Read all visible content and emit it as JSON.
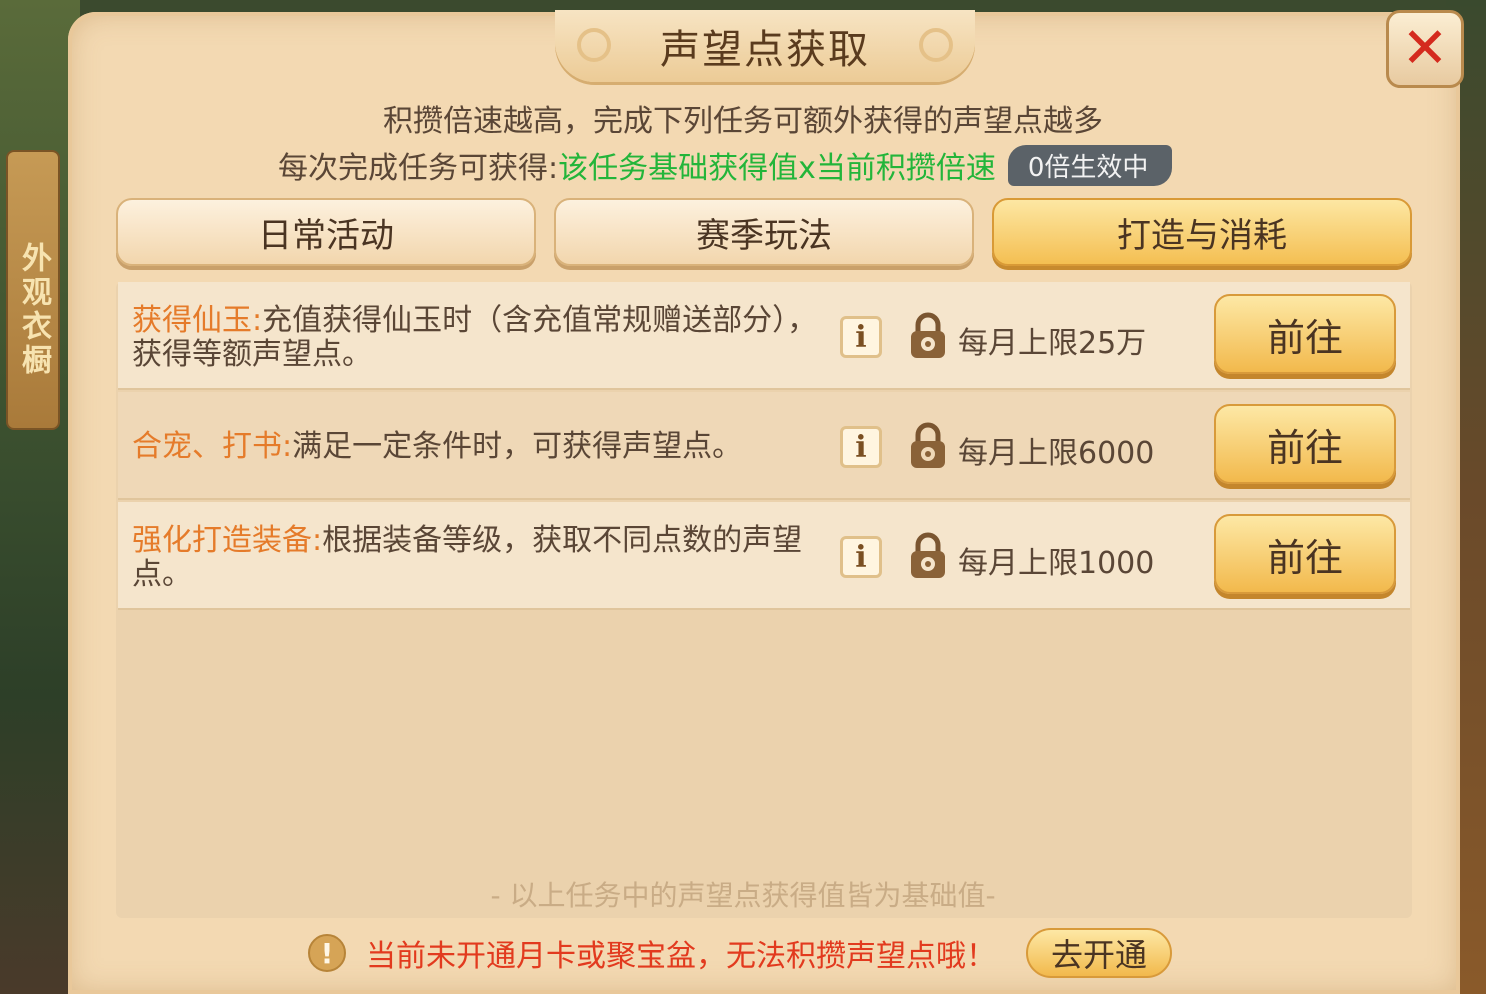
{
  "side_tag": "外观衣橱",
  "dialog": {
    "title": "声望点获取",
    "close_icon": "close-x-icon",
    "subtitle": "积攒倍速越高，完成下列任务可额外获得的声望点越多",
    "formula_prefix": "每次完成任务可获得:",
    "formula_green": "该任务基础获得值x当前积攒倍速",
    "multiplier_badge": "0倍生效中"
  },
  "tabs": [
    {
      "label": "日常活动",
      "active": false
    },
    {
      "label": "赛季玩法",
      "active": false
    },
    {
      "label": "打造与消耗",
      "active": true
    }
  ],
  "tasks": [
    {
      "name": "获得仙玉:",
      "desc": "充值获得仙玉时（含充值常规赠送部分），获得等额声望点。",
      "limit": "每月上限25万",
      "button": "前往"
    },
    {
      "name": "合宠、打书:",
      "desc": "满足一定条件时，可获得声望点。",
      "limit": "每月上限6000",
      "button": "前往"
    },
    {
      "name": "强化打造装备:",
      "desc": "根据装备等级，获取不同点数的声望点。",
      "limit": "每月上限1000",
      "button": "前往"
    }
  ],
  "footnote": "- 以上任务中的声望点获得值皆为基础值-",
  "warning": {
    "text": "当前未开通月卡或聚宝盆，无法积攒声望点哦！",
    "button": "去开通"
  },
  "colors": {
    "panel_bg": "#f3d9b2",
    "accent_orange": "#e57b2a",
    "green_text": "#23b53a",
    "warning_red": "#e23a1e",
    "active_tab": "#f4bf52"
  }
}
